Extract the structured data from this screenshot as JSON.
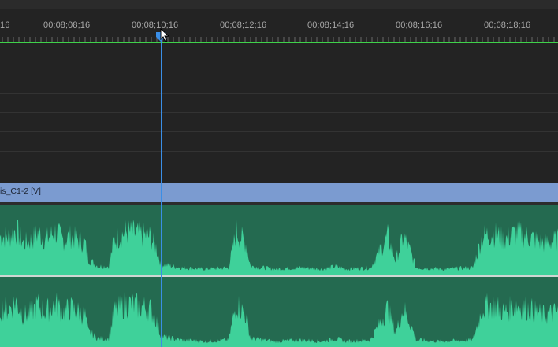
{
  "timeline": {
    "ruler": {
      "timecodes": [
        "16",
        "00;08;08;16",
        "00;08;10;16",
        "00;08;12;16",
        "00;08;14;16",
        "00;08;16;16",
        "00;08;18;16"
      ]
    },
    "video_clip": {
      "name": "is_C1-2 [V]"
    },
    "playhead": {
      "timecode": "00;08;10;16"
    },
    "colors": {
      "work_area_bar": "#3fd14a",
      "playhead": "#3a8ee6",
      "video_clip": "#7b9bd0",
      "audio_clip": "#246a50",
      "waveform": "#3fd19a"
    },
    "icons": {
      "playhead_handle": "playhead-marker-icon",
      "cursor": "pointer-cursor-icon"
    }
  }
}
